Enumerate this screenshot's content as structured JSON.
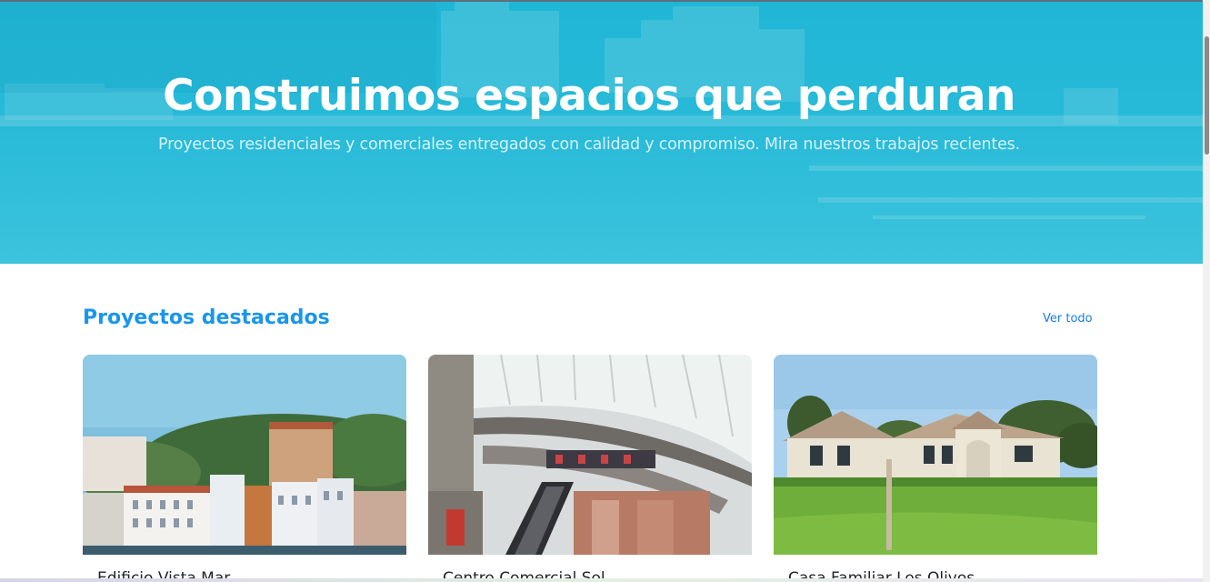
{
  "hero": {
    "title": "Construimos espacios que perduran",
    "subtitle": "Proyectos residenciales y comerciales entregados con calidad y compromiso. Mira nuestros trabajos recientes."
  },
  "featured": {
    "title": "Proyectos destacados",
    "view_all": "Ver todo",
    "projects": [
      {
        "name": "Edificio Vista Mar"
      },
      {
        "name": "Centro Comercial Sol"
      },
      {
        "name": "Casa Familiar Los Olivos"
      }
    ]
  },
  "colors": {
    "hero_overlay": "#20b6d6",
    "section_title": "#1a96ea",
    "link": "#1a7fe0"
  }
}
